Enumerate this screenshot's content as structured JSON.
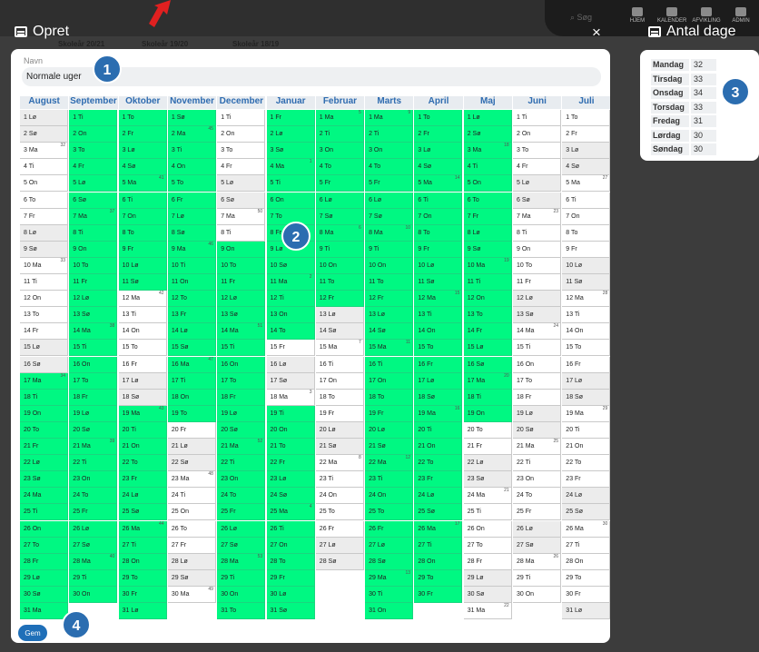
{
  "topbar": {
    "search_label": "Søg",
    "items": [
      "HJEM",
      "KALENDER",
      "AFVIKLING",
      "ADMIN"
    ]
  },
  "opret": {
    "title": "Opret",
    "close_glyph": "×"
  },
  "bg_tabs": [
    "Skoleår 20/21",
    "Skoleår 19/20",
    "Skoleår 18/19"
  ],
  "form": {
    "navn_label": "Navn",
    "navn_value": "Normale uger",
    "save_label": "Gem"
  },
  "antal_dage": {
    "title": "Antal dage",
    "rows": [
      {
        "day": "Mandag",
        "count": "32"
      },
      {
        "day": "Tirsdag",
        "count": "33"
      },
      {
        "day": "Onsdag",
        "count": "34"
      },
      {
        "day": "Torsdag",
        "count": "33"
      },
      {
        "day": "Fredag",
        "count": "31"
      },
      {
        "day": "Lørdag",
        "count": "30"
      },
      {
        "day": "Søndag",
        "count": "30"
      }
    ]
  },
  "badges": [
    "1",
    "2",
    "3",
    "4"
  ],
  "colors": {
    "accent": "#2b6db0",
    "school_day": "#00f882",
    "header_text": "#2f6cb0",
    "arrow": "#e02020"
  },
  "calendar": {
    "months": [
      {
        "name": "August",
        "start": "Lø",
        "days": 31,
        "green": [
          17,
          18,
          19,
          20,
          21,
          22,
          23,
          24,
          25,
          26,
          27,
          28,
          29,
          30,
          31
        ],
        "weeks": {
          "3": 32,
          "10": 33,
          "17": 34
        }
      },
      {
        "name": "September",
        "start": "Ti",
        "days": 30,
        "green": [
          1,
          2,
          3,
          4,
          5,
          6,
          7,
          8,
          9,
          10,
          11,
          12,
          13,
          14,
          15,
          16,
          17,
          18,
          19,
          20,
          21,
          22,
          23,
          24,
          25,
          26,
          27,
          28,
          29,
          30
        ],
        "weeks": {
          "7": 37,
          "14": 38,
          "21": 39,
          "28": 40
        }
      },
      {
        "name": "Oktober",
        "start": "To",
        "days": 31,
        "green": [
          1,
          2,
          3,
          4,
          5,
          6,
          7,
          8,
          9,
          10,
          11,
          19,
          20,
          21,
          22,
          23,
          24,
          25,
          26,
          27,
          28,
          29,
          30,
          31
        ],
        "weeks": {
          "5": 41,
          "12": 42,
          "19": 43,
          "26": 44
        }
      },
      {
        "name": "November",
        "start": "Sø",
        "days": 30,
        "green": [
          1,
          2,
          3,
          4,
          5,
          6,
          7,
          8,
          9,
          10,
          11,
          12,
          13,
          14,
          15,
          16,
          17,
          18,
          19
        ],
        "weeks": {
          "2": 45,
          "9": 46,
          "16": 47,
          "23": 48,
          "30": 49
        }
      },
      {
        "name": "December",
        "start": "Ti",
        "days": 31,
        "green": [
          9,
          10,
          11,
          12,
          13,
          14,
          15,
          16,
          17,
          18,
          19,
          20,
          21,
          22,
          23,
          24,
          25,
          26,
          27,
          28,
          29,
          30,
          31
        ],
        "weeks": {
          "7": 50,
          "14": 51,
          "21": 52,
          "28": 53
        }
      },
      {
        "name": "Januar",
        "start": "Fr",
        "days": 31,
        "green": [
          1,
          2,
          3,
          4,
          5,
          6,
          7,
          8,
          9,
          10,
          11,
          12,
          13,
          14,
          19,
          20,
          21,
          22,
          23,
          24,
          25,
          26,
          27,
          28,
          29,
          30,
          31
        ],
        "weeks": {
          "4": 1,
          "11": 2,
          "18": 3,
          "25": 4
        }
      },
      {
        "name": "Februar",
        "start": "Ma",
        "days": 28,
        "green": [
          1,
          2,
          3,
          4,
          5,
          6,
          7,
          8,
          9,
          10,
          11,
          12
        ],
        "weeks": {
          "1": 5,
          "8": 6,
          "15": 7,
          "22": 8
        }
      },
      {
        "name": "Marts",
        "start": "Ma",
        "days": 31,
        "green": [
          1,
          2,
          3,
          4,
          5,
          6,
          7,
          8,
          9,
          10,
          11,
          12,
          13,
          14,
          15,
          16,
          17,
          18,
          19,
          20,
          21,
          22,
          23,
          24,
          25,
          26,
          27,
          28,
          29,
          30,
          31
        ],
        "weeks": {
          "1": 9,
          "8": 10,
          "15": 11,
          "22": 12,
          "29": 13
        }
      },
      {
        "name": "April",
        "start": "To",
        "days": 30,
        "green": [
          1,
          2,
          3,
          4,
          5,
          6,
          7,
          8,
          9,
          10,
          11,
          12,
          13,
          14,
          15,
          16,
          17,
          18,
          19,
          20,
          21,
          22,
          23,
          24,
          25,
          26,
          27,
          28,
          29,
          30
        ],
        "weeks": {
          "5": 14,
          "12": 15,
          "19": 16,
          "26": 17
        }
      },
      {
        "name": "Maj",
        "start": "Lø",
        "days": 31,
        "green": [
          1,
          2,
          3,
          4,
          5,
          6,
          7,
          8,
          9,
          10,
          11,
          12,
          13,
          14,
          15,
          16,
          17,
          18,
          19
        ],
        "weeks": {
          "3": 18,
          "10": 19,
          "17": 20,
          "24": 21,
          "31": 22
        }
      },
      {
        "name": "Juni",
        "start": "Ti",
        "days": 30,
        "green": [],
        "weeks": {
          "7": 23,
          "14": 24,
          "21": 25,
          "28": 26
        }
      },
      {
        "name": "Juli",
        "start": "To",
        "days": 31,
        "green": [],
        "weeks": {
          "5": 27,
          "12": 28,
          "19": 29,
          "26": 30
        }
      }
    ]
  }
}
